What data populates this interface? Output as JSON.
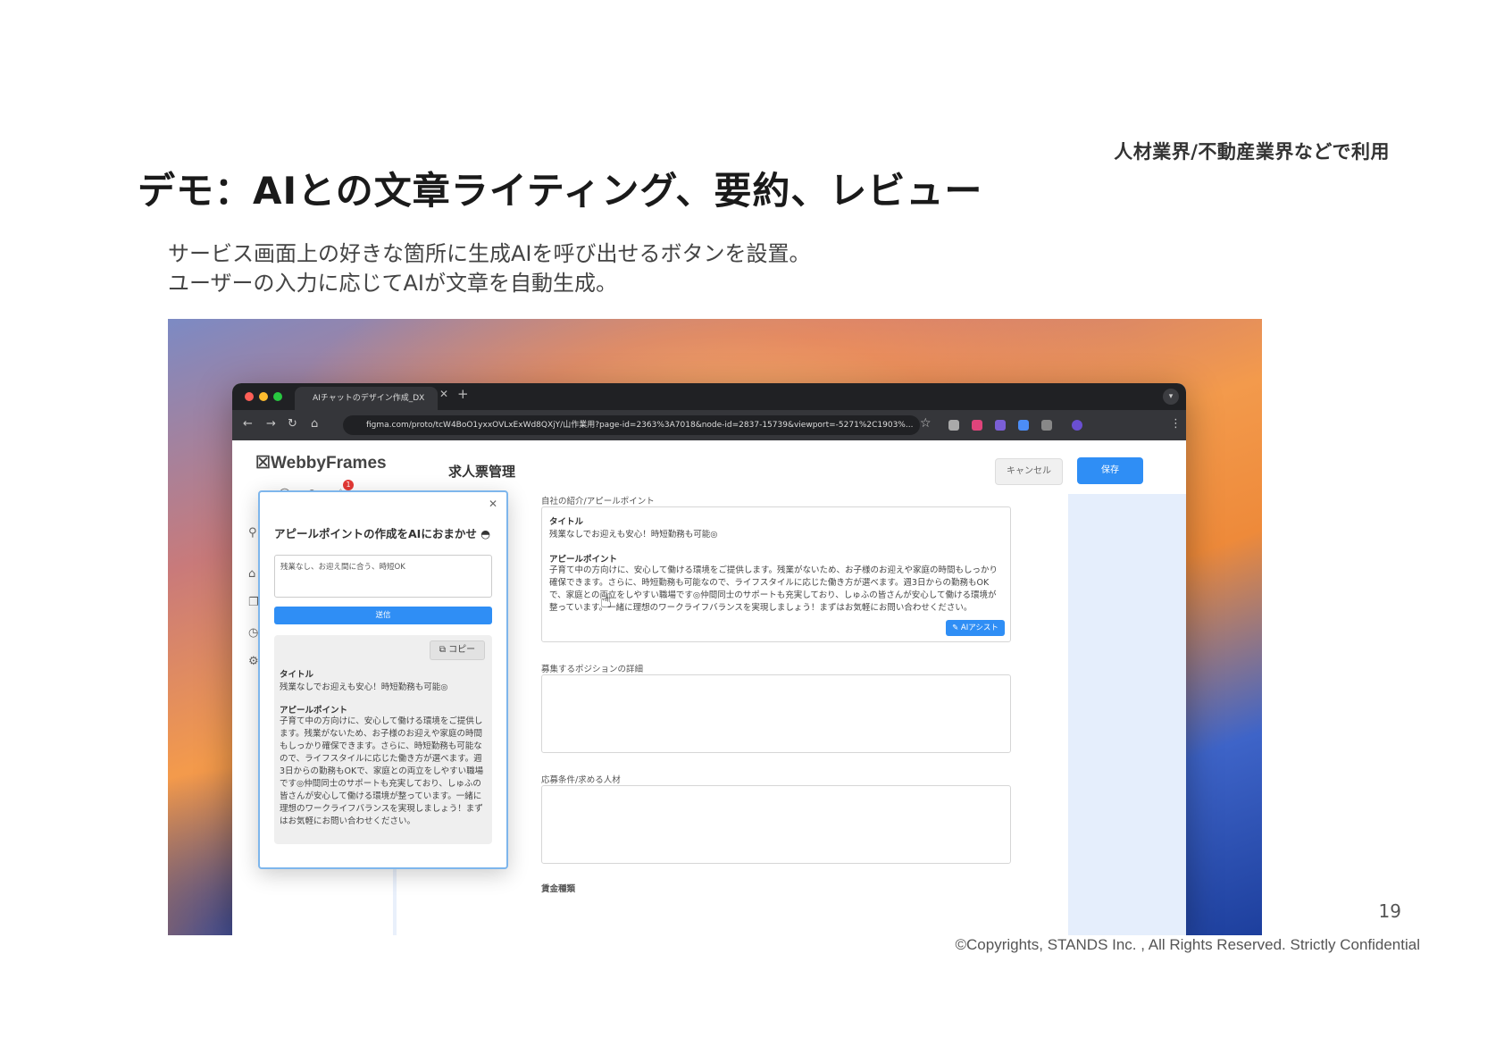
{
  "slide": {
    "tag": "人材業界/不動産業界などで利用",
    "title": "デモ：AIとの文章ライティング、要約、レビュー",
    "description_line1": "サービス画面上の好きな箇所に生成AIを呼び出せるボタンを設置。",
    "description_line2": "ユーザーの入力に応じてAIが文章を自動生成。",
    "page_number": "19",
    "copyright": "©Copyrights, STANDS Inc. , All Rights Reserved. Strictly Confidential"
  },
  "browser": {
    "tab_title": "AIチャットのデザイン作成_DX",
    "url": "figma.com/proto/tcW4BoO1yxxOVLxExWd8QXjY/山作業用?page-id=2363%3A7018&node-id=2837-15739&viewport=-5271%2C1903%..."
  },
  "app": {
    "logo": "WebbyFrames",
    "page_heading": "求人票管理",
    "badge_count": "1",
    "cancel_label": "キャンセル",
    "save_label": "保存",
    "section1_label": "自社の紹介/アピールポイント",
    "section1_title_label": "タイトル",
    "section1_title": "残業なしでお迎えも安心！時短勤務も可能◎",
    "section1_appeal_label": "アピールポイント",
    "section1_appeal": "子育て中の方向けに、安心して働ける環境をご提供します。残業がないため、お子様のお迎えや家庭の時間もしっかり確保できます。さらに、時短勤務も可能なので、ライフスタイルに応じた働き方が選べます。週3日からの勤務もOKで、家庭との両立をしやすい職場です◎仲間同士のサポートも充実しており、しゅふの皆さんが安心して働ける環境が整っています。一緒に理想のワークライフバランスを実現しましょう！まずはお気軽にお問い合わせください。",
    "ai_assist_label": "AIアシスト",
    "section2_label": "募集するポジションの詳細",
    "section3_label": "応募条件/求める人材",
    "section4_label": "賃金種類"
  },
  "popup": {
    "title": "アピールポイントの作成をAIにおまかせ",
    "input_value": "残業なし、お迎え間に合う、時短OK",
    "send_label": "送信",
    "copy_label": "コピー",
    "result_title_label": "タイトル",
    "result_title": "残業なしでお迎えも安心！時短勤務も可能◎",
    "result_appeal_label": "アピールポイント",
    "result_appeal": "子育て中の方向けに、安心して働ける環境をご提供します。残業がないため、お子様のお迎えや家庭の時間もしっかり確保できます。さらに、時短勤務も可能なので、ライフスタイルに応じた働き方が選べます。週3日からの勤務もOKで、家庭との両立をしやすい職場です◎仲間同士のサポートも充実しており、しゅふの皆さんが安心して働ける環境が整っています。一緒に理想のワークライフバランスを実現しましょう！まずはお気軽にお問い合わせください。"
  },
  "colors": {
    "accent": "#2f8ef5",
    "popup_border": "#7eb6ec",
    "panel_bg": "#e5eefc"
  }
}
